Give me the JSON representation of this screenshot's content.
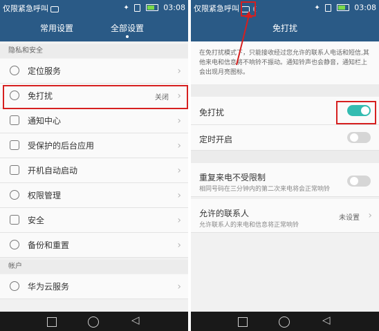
{
  "status": {
    "carrier": "仅限紧急呼叫",
    "time": "03:08"
  },
  "left": {
    "tabs": [
      "常用设置",
      "全部设置"
    ],
    "sections": [
      {
        "title": "隐私和安全",
        "items": [
          {
            "label": "定位服务",
            "value": ""
          },
          {
            "label": "免打扰",
            "value": "关闭"
          },
          {
            "label": "通知中心",
            "value": ""
          },
          {
            "label": "受保护的后台应用",
            "value": ""
          },
          {
            "label": "开机自动启动",
            "value": ""
          },
          {
            "label": "权限管理",
            "value": ""
          },
          {
            "label": "安全",
            "value": ""
          },
          {
            "label": "备份和重置",
            "value": ""
          }
        ]
      },
      {
        "title": "帐户",
        "items": [
          {
            "label": "华为云服务",
            "value": ""
          }
        ]
      }
    ]
  },
  "right": {
    "title": "免打扰",
    "description": "在免打扰模式下，只能接收经过您允许的联系人电话和短信,其他来电和信息将不响铃不振动。通知铃声也会静音，通知栏上会出现月亮图标。",
    "rows": [
      {
        "label": "免打扰",
        "sub": "",
        "on": true
      },
      {
        "label": "定时开启",
        "sub": "",
        "on": false
      },
      {
        "label": "重复来电不受限制",
        "sub": "相同号码在三分钟内的第二次来电将会正常响铃",
        "on": false
      },
      {
        "label": "允许的联系人",
        "sub": "允许联系人的来电和信息将正常响铃",
        "value": "未设置"
      }
    ]
  }
}
